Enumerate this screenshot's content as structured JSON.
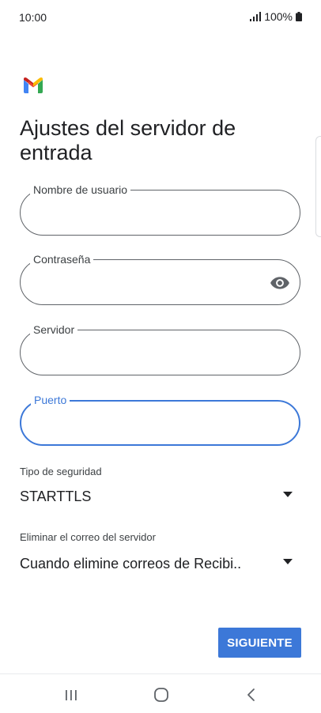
{
  "status_bar": {
    "time": "10:00",
    "battery": "100%"
  },
  "logo": {
    "icon": "gmail-logo-icon"
  },
  "title": "Ajustes del servidor de entrada",
  "fields": {
    "username": {
      "label": "Nombre de usuario",
      "value": ""
    },
    "password": {
      "label": "Contraseña",
      "value": "",
      "icon": "eye-icon"
    },
    "server": {
      "label": "Servidor",
      "value": ""
    },
    "port": {
      "label": "Puerto",
      "value": ""
    }
  },
  "security": {
    "label": "Tipo de seguridad",
    "value": "STARTTLS"
  },
  "delete_mail": {
    "label": "Eliminar el correo del servidor",
    "value": "Cuando elimine correos de Recibi.."
  },
  "next_button": "SIGUIENTE",
  "colors": {
    "accent": "#3c78d8",
    "text": "#202124",
    "border": "#5f6368"
  }
}
